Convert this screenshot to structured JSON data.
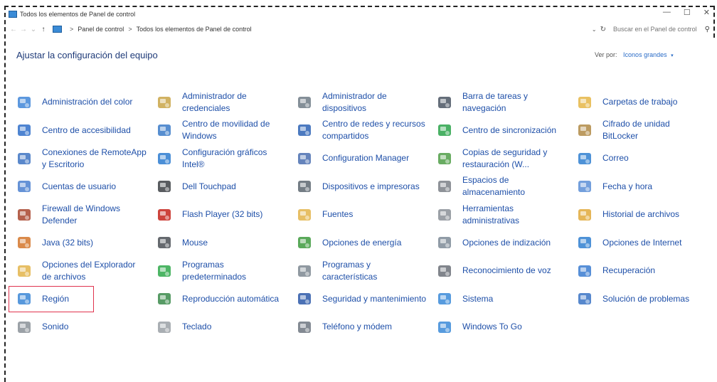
{
  "window": {
    "title": "Todos los elementos de Panel de control",
    "controls": {
      "minimize": "—",
      "maximize": "☐",
      "close": "✕"
    }
  },
  "address": {
    "back": "←",
    "forward": "→",
    "recent": "⌄",
    "up": "↑",
    "breadcrumbs": [
      "Panel de control",
      "Todos los elementos de Panel de control"
    ],
    "separator": ">",
    "dropdown": "⌄",
    "refresh": "↻",
    "search_placeholder": "Buscar en el Panel de control",
    "search_glyph": "⚲"
  },
  "header": {
    "title": "Ajustar la configuración del equipo",
    "view_by_label": "Ver por:",
    "view_by_value": "Iconos grandes",
    "view_by_caret": "▾"
  },
  "items": [
    {
      "label": "Administración del color",
      "icon": "color-management-icon",
      "color": "#3f86d8"
    },
    {
      "label": "Administrador de credenciales",
      "icon": "credential-manager-icon",
      "color": "#c9a546"
    },
    {
      "label": "Administrador de dispositivos",
      "icon": "device-manager-icon",
      "color": "#6f7b86"
    },
    {
      "label": "Barra de tareas y navegación",
      "icon": "taskbar-icon",
      "color": "#4a5563"
    },
    {
      "label": "Carpetas de trabajo",
      "icon": "work-folders-icon",
      "color": "#e5b646"
    },
    {
      "label": "Centro de accesibilidad",
      "icon": "ease-of-access-icon",
      "color": "#2f6fc9"
    },
    {
      "label": "Centro de movilidad de Windows",
      "icon": "mobility-center-icon",
      "color": "#3a7ac8"
    },
    {
      "label": "Centro de redes y recursos compartidos",
      "icon": "network-center-icon",
      "color": "#2d63b5"
    },
    {
      "label": "Centro de sincronización",
      "icon": "sync-center-icon",
      "color": "#2aa34a"
    },
    {
      "label": "Cifrado de unidad BitLocker",
      "icon": "bitlocker-icon",
      "color": "#b08a45"
    },
    {
      "label": "Conexiones de RemoteApp y Escritorio",
      "icon": "remoteapp-icon",
      "color": "#3d73c2"
    },
    {
      "label": "Configuración gráficos Intel®",
      "icon": "intel-graphics-icon",
      "color": "#2b7bd0"
    },
    {
      "label": "Configuration Manager",
      "icon": "configuration-manager-icon",
      "color": "#4a6fb0"
    },
    {
      "label": "Copias de seguridad y restauración (W...",
      "icon": "backup-restore-icon",
      "color": "#4f9d46"
    },
    {
      "label": "Correo",
      "icon": "mail-icon",
      "color": "#2f7fd0"
    },
    {
      "label": "Cuentas de usuario",
      "icon": "user-accounts-icon",
      "color": "#4a7fcf"
    },
    {
      "label": "Dell Touchpad",
      "icon": "touchpad-icon",
      "color": "#3c3f44"
    },
    {
      "label": "Dispositivos e impresoras",
      "icon": "devices-printers-icon",
      "color": "#5c6670"
    },
    {
      "label": "Espacios de almacenamiento",
      "icon": "storage-spaces-icon",
      "color": "#7a7f86"
    },
    {
      "label": "Fecha y hora",
      "icon": "date-time-icon",
      "color": "#5b8ed6"
    },
    {
      "label": "Firewall de Windows Defender",
      "icon": "firewall-icon",
      "color": "#a8452e"
    },
    {
      "label": "Flash Player (32 bits)",
      "icon": "flash-player-icon",
      "color": "#c4231a"
    },
    {
      "label": "Fuentes",
      "icon": "fonts-icon",
      "color": "#e3b44a"
    },
    {
      "label": "Herramientas administrativas",
      "icon": "admin-tools-icon",
      "color": "#8a8f96"
    },
    {
      "label": "Historial de archivos",
      "icon": "file-history-icon",
      "color": "#e0a93b"
    },
    {
      "label": "Java (32 bits)",
      "icon": "java-icon",
      "color": "#d4762a"
    },
    {
      "label": "Mouse",
      "icon": "mouse-icon",
      "color": "#4a4f55"
    },
    {
      "label": "Opciones de energía",
      "icon": "power-options-icon",
      "color": "#3d9a3d"
    },
    {
      "label": "Opciones de indización",
      "icon": "indexing-options-icon",
      "color": "#7d8a96"
    },
    {
      "label": "Opciones de Internet",
      "icon": "internet-options-icon",
      "color": "#2f7fd0"
    },
    {
      "label": "Opciones del Explorador de archivos",
      "icon": "file-explorer-options-icon",
      "color": "#e3b44a"
    },
    {
      "label": "Programas predeterminados",
      "icon": "default-programs-icon",
      "color": "#2ea84a"
    },
    {
      "label": "Programas y características",
      "icon": "programs-features-icon",
      "color": "#7d8791"
    },
    {
      "label": "Reconocimiento de voz",
      "icon": "speech-recognition-icon",
      "color": "#6b7078"
    },
    {
      "label": "Recuperación",
      "icon": "recovery-icon",
      "color": "#3a7bd0"
    },
    {
      "label": "Región",
      "icon": "region-icon",
      "color": "#3a86d6",
      "selected": true
    },
    {
      "label": "Reproducción automática",
      "icon": "autoplay-icon",
      "color": "#3a8a4a"
    },
    {
      "label": "Seguridad y mantenimiento",
      "icon": "security-maintenance-icon",
      "color": "#2b58a8"
    },
    {
      "label": "Sistema",
      "icon": "system-icon",
      "color": "#3a8ad8"
    },
    {
      "label": "Solución de problemas",
      "icon": "troubleshooting-icon",
      "color": "#3a73c4"
    },
    {
      "label": "Sonido",
      "icon": "sound-icon",
      "color": "#8a9098"
    },
    {
      "label": "Teclado",
      "icon": "keyboard-icon",
      "color": "#9aa0a6"
    },
    {
      "label": "Teléfono y módem",
      "icon": "phone-modem-icon",
      "color": "#6d7680"
    },
    {
      "label": "Windows To Go",
      "icon": "windows-to-go-icon",
      "color": "#3a8ad8"
    }
  ]
}
